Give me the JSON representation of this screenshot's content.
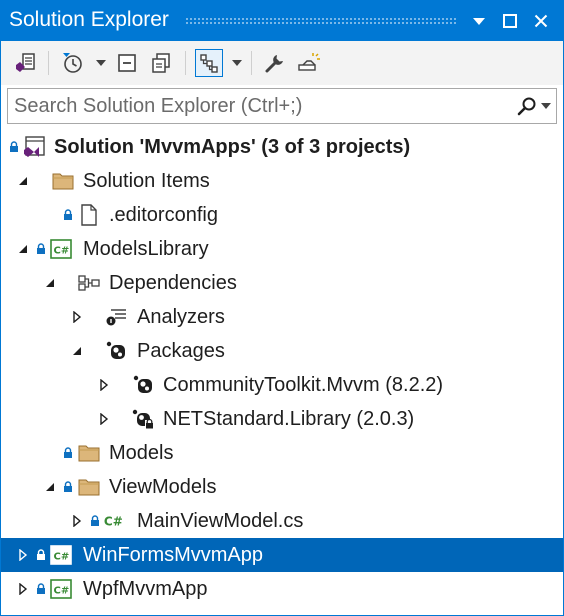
{
  "window": {
    "title": "Solution Explorer",
    "accent_color": "#0078d4",
    "selected_color": "#0066b8",
    "title_icons": [
      "pin-dropdown-icon",
      "maximize-icon",
      "close-icon"
    ]
  },
  "toolbar": {
    "tools": [
      "switch-views-icon",
      "pending-changes-filter-icon",
      "collapse-all-icon",
      "show-all-files-icon",
      "sync-with-active-document-icon",
      "properties-wrench-icon",
      "preview-selected-items-icon"
    ]
  },
  "search": {
    "placeholder": "Search Solution Explorer (Ctrl+;)",
    "value": ""
  },
  "tree": {
    "nodes": [
      {
        "label": "Solution 'MvvmApps' (3 of 3 projects)",
        "icon": "solution-icon",
        "lock": true,
        "expander": "none",
        "bold": true
      },
      {
        "label": "Solution Items",
        "icon": "folder-icon",
        "lock": false,
        "expander": "expanded"
      },
      {
        "label": ".editorconfig",
        "icon": "file-icon",
        "lock": true,
        "expander": "none"
      },
      {
        "label": "ModelsLibrary",
        "icon": "csharp-project-icon",
        "lock": true,
        "expander": "expanded"
      },
      {
        "label": "Dependencies",
        "icon": "dependencies-icon",
        "lock": false,
        "expander": "expanded"
      },
      {
        "label": "Analyzers",
        "icon": "analyzers-icon",
        "lock": false,
        "expander": "collapsed"
      },
      {
        "label": "Packages",
        "icon": "package-icon",
        "lock": false,
        "expander": "expanded"
      },
      {
        "label": "CommunityToolkit.Mvvm (8.2.2)",
        "icon": "package-icon",
        "lock": false,
        "expander": "collapsed"
      },
      {
        "label": "NETStandard.Library (2.0.3)",
        "icon": "package-lock-icon",
        "lock": false,
        "expander": "collapsed"
      },
      {
        "label": "Models",
        "icon": "folder-icon",
        "lock": true,
        "expander": "none"
      },
      {
        "label": "ViewModels",
        "icon": "folder-icon",
        "lock": true,
        "expander": "expanded"
      },
      {
        "label": "MainViewModel.cs",
        "icon": "csharp-file-icon",
        "lock": true,
        "expander": "collapsed"
      },
      {
        "label": "WinFormsMvvmApp",
        "icon": "csharp-project-icon",
        "lock": true,
        "expander": "collapsed",
        "selected": true
      },
      {
        "label": "WpfMvvmApp",
        "icon": "csharp-project-icon",
        "lock": true,
        "expander": "collapsed"
      }
    ]
  }
}
